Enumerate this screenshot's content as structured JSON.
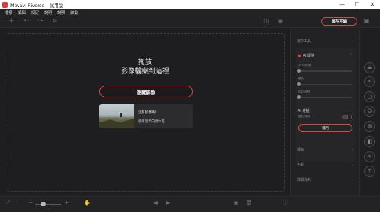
{
  "window": {
    "title": "Movavi Riverse – 試用版",
    "controls": {
      "minimize": "—",
      "maximize": "☐",
      "close": "✕"
    }
  },
  "menu": [
    "檔案",
    "編輯",
    "設定",
    "說明",
    "說明",
    "啟動"
  ],
  "toolbar": {
    "icons": [
      "add-icon",
      "undo-icon",
      "redo-icon",
      "reset-icon",
      "compare-icon",
      "preview-icon",
      "save-icon"
    ],
    "export_label": "儲存至編"
  },
  "canvas": {
    "drop_line1": "拖放",
    "drop_line2": "影像檔案到這裡",
    "browse_label": "瀏覽影像",
    "sample": {
      "question": "沒有影像嗎？",
      "link": "使用我們的樣本吧"
    }
  },
  "panel": {
    "top_heading": "選擇工具",
    "ai_title": "AI 調整",
    "sliders": [
      {
        "label": "HDR照明",
        "value": 0
      },
      {
        "label": "曝光",
        "value": 0
      },
      {
        "label": "大自調整",
        "value": 0
      }
    ],
    "ai_section": "AI 雜點",
    "toggle_label": "雜點消除",
    "toggle_on": false,
    "apply_label": "套用",
    "sections": [
      "濾鏡",
      "色彩",
      "詳細資料"
    ]
  },
  "rail_icons": [
    "sliders-icon",
    "crop-icon",
    "frame-icon",
    "palette-icon",
    "image-icon",
    "text-icon"
  ],
  "bottombar": {
    "icons": [
      "fit-icon",
      "actual-size-icon",
      "zoom-out-icon",
      "zoom-in-icon",
      "hand-icon",
      "prev-icon",
      "next-icon",
      "gallery-icon",
      "delete-icon",
      "info-icon"
    ],
    "zoom_level": 0.25
  },
  "colors": {
    "accent": "#e0433f",
    "background": "#1b1b1d"
  }
}
